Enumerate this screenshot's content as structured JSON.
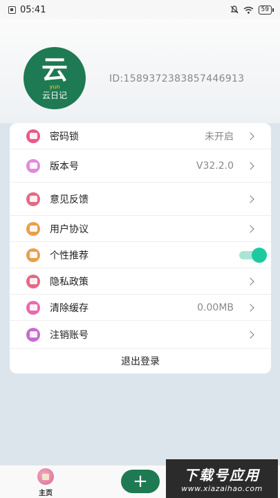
{
  "status_bar": {
    "time": "05:41",
    "battery": "59"
  },
  "profile": {
    "avatar_glyph": "云",
    "avatar_sub": "yun",
    "avatar_name": "云日记",
    "user_id": "ID:1589372383857446913"
  },
  "colors": {
    "brand_green": "#1e7a52",
    "toggle_on": "#1ec9a0"
  },
  "settings": {
    "password_lock": {
      "label": "密码锁",
      "value": "未开启",
      "icon": "lock-icon"
    },
    "version": {
      "label": "版本号",
      "value": "V32.2.0",
      "icon": "info-icon"
    },
    "feedback": {
      "label": "意见反馈",
      "icon": "feedback-icon"
    },
    "user_agreement": {
      "label": "用户协议",
      "icon": "agreement-icon"
    },
    "personalized": {
      "label": "个性推荐",
      "icon": "recommend-icon",
      "enabled": true
    },
    "privacy": {
      "label": "隐私政策",
      "icon": "privacy-icon"
    },
    "cache": {
      "label": "清除缓存",
      "value": "0.00MB",
      "icon": "cache-icon"
    },
    "cancel_account": {
      "label": "注销账号",
      "icon": "cancel-account-icon"
    },
    "logout": "退出登录"
  },
  "bottom_nav": {
    "home_label": "主页",
    "add_label": "+"
  },
  "watermark": {
    "title": "下载号应用",
    "url": "www.xiazaihao.com"
  }
}
